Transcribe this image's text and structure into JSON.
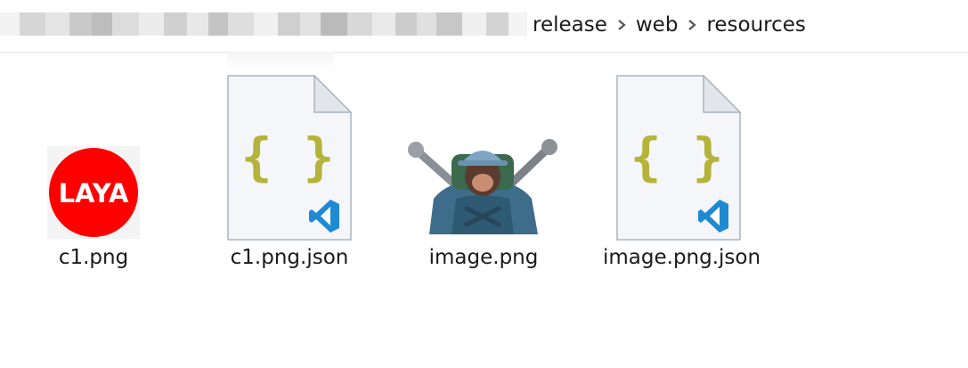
{
  "breadcrumb": {
    "items": [
      "release",
      "web",
      "resources"
    ],
    "separator_icon": "chevron-right-icon"
  },
  "files": [
    {
      "name": "c1.png",
      "icon": "laya-logo-icon",
      "logo_text": "LAYA",
      "logo_color": "#ff0000"
    },
    {
      "name": "c1.png.json",
      "icon": "json-file-icon",
      "glyph": "{ }",
      "glyph_color": "#b5b43a",
      "badge": "vscode-icon"
    },
    {
      "name": "image.png",
      "icon": "image-thumbnail"
    },
    {
      "name": "image.png.json",
      "icon": "json-file-icon",
      "glyph": "{ }",
      "glyph_color": "#b5b43a",
      "badge": "vscode-icon"
    }
  ],
  "colors": {
    "vscode_blue": "#1f8ad2",
    "selection_border": "#e3e3e3"
  }
}
